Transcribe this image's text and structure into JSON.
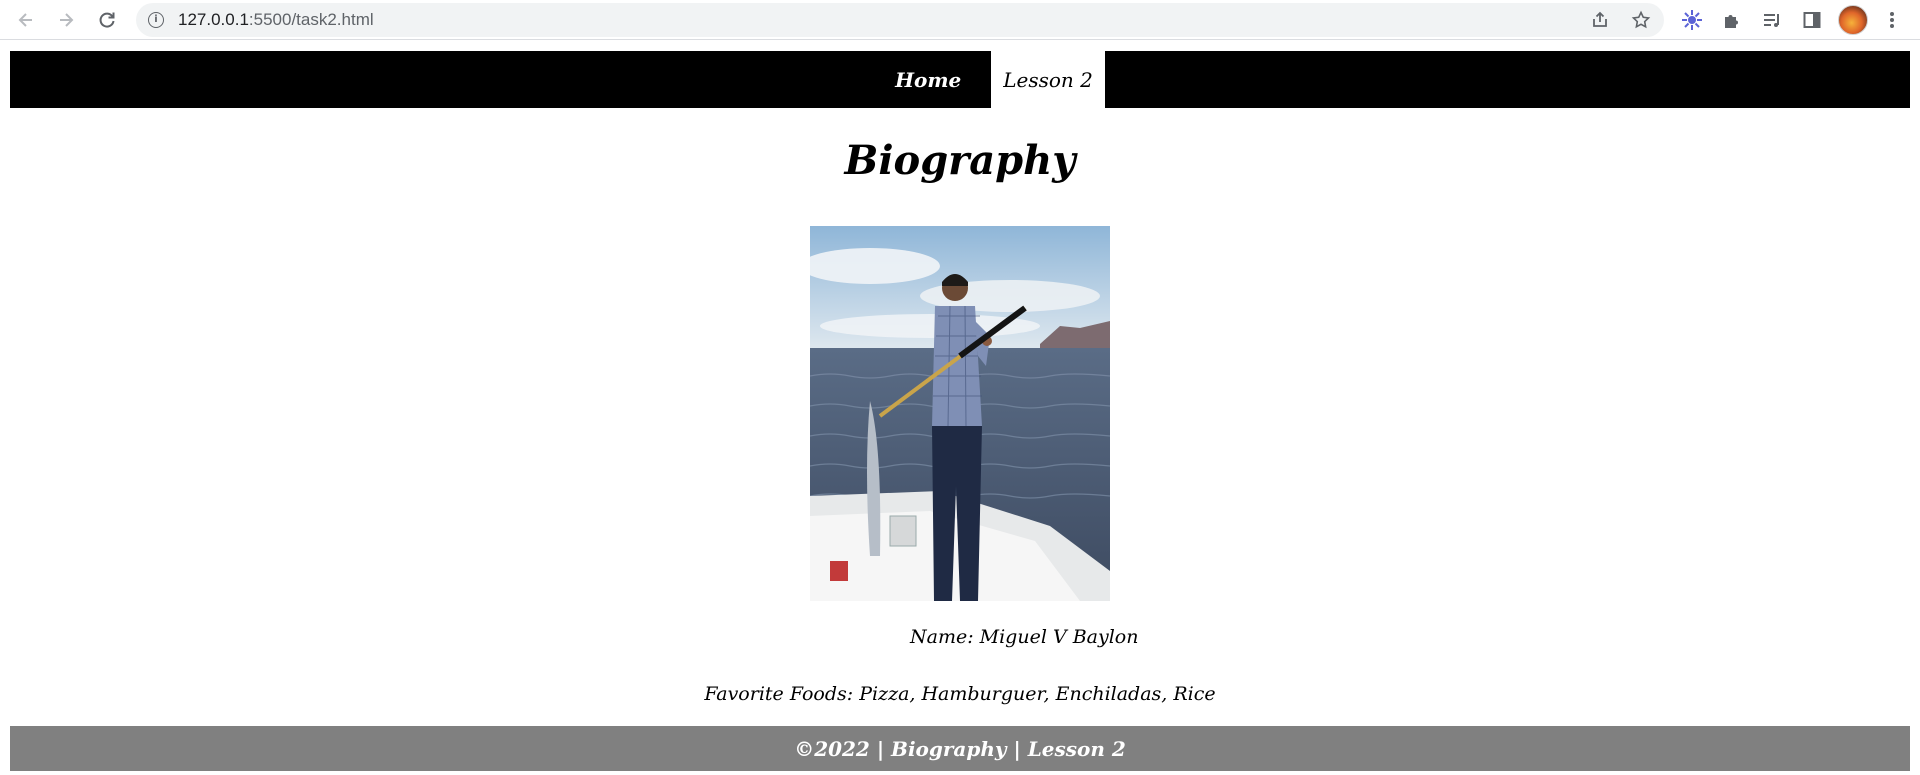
{
  "browser": {
    "url_host": "127.0.0.1",
    "url_path": ":5500/task2.html",
    "icons": {
      "back": "arrow-left-icon",
      "forward": "arrow-right-icon",
      "reload": "reload-icon",
      "site_info": "info-icon",
      "share": "share-icon",
      "bookmark": "star-icon",
      "extension_1": "sparkle-extension-icon",
      "extensions": "puzzle-icon",
      "reading_list": "reading-list-icon",
      "side_panel": "side-panel-icon",
      "profile": "avatar",
      "menu": "kebab-menu-icon"
    }
  },
  "nav": {
    "items": [
      {
        "label": "Home",
        "active": false
      },
      {
        "label": "Lesson 2",
        "active": true
      }
    ]
  },
  "main": {
    "title": "Biography",
    "photo_alt": "Man holding a harpoon on a boat at sea",
    "name_text": "Name: Miguel V Baylon",
    "foods_text": "Favorite Foods: Pizza, Hamburguer, Enchiladas, Rice"
  },
  "footer": {
    "text": "©2022 | Biography | Lesson 2"
  },
  "colors": {
    "nav_bg": "#000000",
    "footer_bg": "#808080",
    "page_bg": "#ffffff"
  }
}
